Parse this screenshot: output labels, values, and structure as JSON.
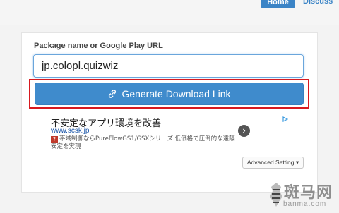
{
  "nav": {
    "home_label": "Home",
    "discuss_label": "Discuss"
  },
  "form": {
    "label": "Package name or Google Play URL",
    "input_value": "jp.colopl.quizwiz",
    "generate_label": "Generate Download Link",
    "generate_icon": "link-icon",
    "advanced_label": "Advanced Setting ▾"
  },
  "ad": {
    "title": "不安定なアプリ環境を改善",
    "url": "www.scsk.jp",
    "description": "帯域制御ならPureFlowGS1/GSXシリーズ 低価格で圧倒的な遠隔安定を実現",
    "badge": "?",
    "arrow_icon": "chevron-right-icon",
    "ad_choices_icon": "ad-choices-icon"
  },
  "watermark": {
    "text": "斑马网",
    "sub": "banma.com"
  },
  "colors": {
    "accent": "#3f8bcc",
    "highlight": "#d7191f"
  }
}
